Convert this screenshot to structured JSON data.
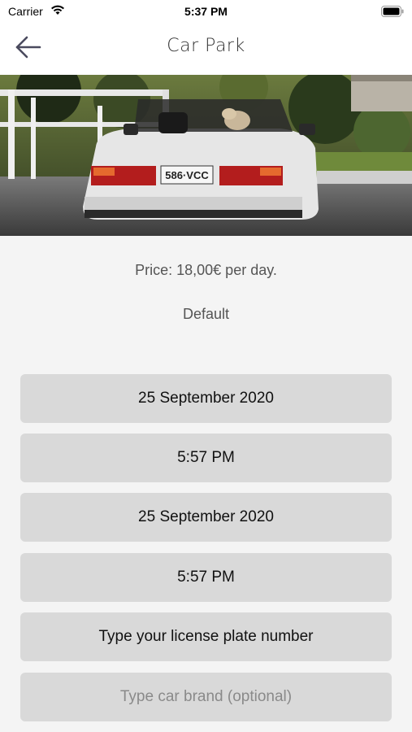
{
  "status_bar": {
    "carrier": "Carrier",
    "time": "5:37 PM"
  },
  "nav": {
    "title": "Car Park"
  },
  "hero": {
    "plate": "586·VCC"
  },
  "info": {
    "price": "Price: 18,00€ per day.",
    "default_label": "Default"
  },
  "form": {
    "start_date": "25 September 2020",
    "start_time": "5:57 PM",
    "end_date": "25 September 2020",
    "end_time": "5:57 PM",
    "license_plate_placeholder": "Type your license plate number",
    "car_brand_placeholder": "Type car brand (optional)"
  }
}
